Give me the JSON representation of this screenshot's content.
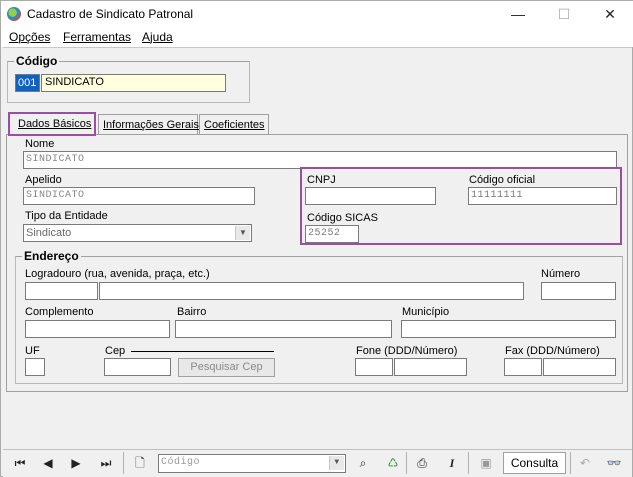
{
  "window": {
    "title": "Cadastro de Sindicato Patronal",
    "minimize_glyph": "—",
    "maximize_glyph": "☐",
    "close_glyph": "✕"
  },
  "menu": {
    "items": [
      "Opções",
      "Ferramentas",
      "Ajuda"
    ]
  },
  "codigo": {
    "label": "Código",
    "code": "001",
    "value": "SINDICATO"
  },
  "tabs": [
    "Dados Básicos",
    "Informações Gerais",
    "Coeficientes"
  ],
  "dados_basicos": {
    "nome_label": "Nome",
    "nome_value": "SINDICATO",
    "apelido_label": "Apelido",
    "apelido_value": "SINDICATO",
    "tipo_label": "Tipo da Entidade",
    "tipo_value": "Sindicato",
    "cnpj_label": "CNPJ",
    "cnpj_value": "",
    "codigo_oficial_label": "Código oficial",
    "codigo_oficial_value": "11111111",
    "codigo_sicas_label": "Código SICAS",
    "codigo_sicas_value": "25252"
  },
  "endereco": {
    "title": "Endereço",
    "logradouro_label": "Logradouro (rua, avenida, praça, etc.)",
    "numero_label": "Número",
    "complemento_label": "Complemento",
    "bairro_label": "Bairro",
    "municipio_label": "Município",
    "uf_label": "UF",
    "cep_label": "Cep",
    "pesquisar_cep_label": "Pesquisar Cep",
    "fone_label": "Fone (DDD/Número)",
    "fax_label": "Fax (DDD/Número)"
  },
  "toolbar": {
    "search_field_placeholder": "Código",
    "mode_label": "Consulta",
    "icons": [
      "first-record-icon",
      "previous-record-icon",
      "next-record-icon",
      "last-record-icon",
      "new-document-icon",
      "filter-icon",
      "delete-icon",
      "print-icon",
      "italic-i-icon",
      "save-icon",
      "undo-icon",
      "binoculars-icon"
    ]
  },
  "colors": {
    "highlight": "#9b4ca3",
    "selection": "#0a63c6",
    "field_yellow": "#ffffe0"
  }
}
